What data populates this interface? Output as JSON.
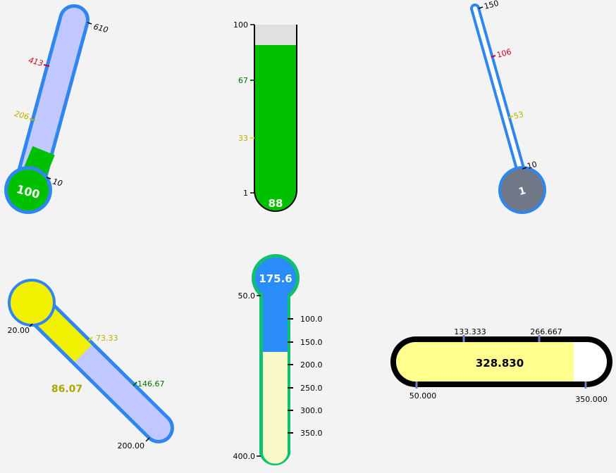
{
  "chart_data": [
    {
      "type": "thermometer",
      "value_label": "100",
      "ticks": [
        {
          "label": "10",
          "color": "#000000"
        },
        {
          "label": "206",
          "color": "#b8b000"
        },
        {
          "label": "413",
          "color": "#d0001a"
        },
        {
          "label": "610",
          "color": "#000000"
        }
      ],
      "range": [
        10,
        610
      ],
      "fill_level": 0.3,
      "colors": {
        "frame": "#2f86f0",
        "track": "#c0c8ff",
        "fill": "#00c000",
        "bulb": "#00c000",
        "value_text": "#ffffff"
      },
      "orientation": "tilted"
    },
    {
      "type": "thermometer",
      "value_label": "88",
      "ticks": [
        {
          "label": "1",
          "color": "#000000"
        },
        {
          "label": "33",
          "color": "#b8b000"
        },
        {
          "label": "67",
          "color": "#007000"
        },
        {
          "label": "100",
          "color": "#000000"
        }
      ],
      "range": [
        1,
        100
      ],
      "fill_level": 0.88,
      "colors": {
        "frame": "#000000",
        "track": "#e0e0e0",
        "fill": "#00c000",
        "bulb": "#00c000",
        "value_text": "#ffffff"
      },
      "orientation": "vertical"
    },
    {
      "type": "thermometer",
      "value_label": "1",
      "ticks": [
        {
          "label": "10",
          "color": "#000000"
        },
        {
          "label": "53",
          "color": "#b8b000"
        },
        {
          "label": "106",
          "color": "#d0001a"
        },
        {
          "label": "150",
          "color": "#000000"
        }
      ],
      "range": [
        10,
        150
      ],
      "fill_level": 0.0,
      "colors": {
        "frame": "#2f86f0",
        "track": "#ffffff",
        "fill": "#707888",
        "bulb": "#707888",
        "value_text": "#ffffff"
      },
      "orientation": "tilted"
    },
    {
      "type": "thermometer",
      "value_label": "86.07",
      "ticks": [
        {
          "label": "20.00",
          "color": "#000000"
        },
        {
          "label": "73.33",
          "color": "#b8b000"
        },
        {
          "label": "146.67",
          "color": "#007000"
        },
        {
          "label": "200.00",
          "color": "#000000"
        }
      ],
      "range": [
        20,
        200
      ],
      "fill_level": 0.37,
      "colors": {
        "frame": "#2f86f0",
        "track": "#c0c8ff",
        "fill": "#f0f000",
        "bulb": "#f0f000",
        "value_text": "#a8a800"
      },
      "orientation": "tilted-down"
    },
    {
      "type": "thermometer",
      "value_label": "175.6",
      "ticks": [
        {
          "label": "50.0",
          "color": "#000000"
        },
        {
          "label": "100.0",
          "color": "#000000"
        },
        {
          "label": "150.0",
          "color": "#000000"
        },
        {
          "label": "200.0",
          "color": "#000000"
        },
        {
          "label": "250.0",
          "color": "#000000"
        },
        {
          "label": "300.0",
          "color": "#000000"
        },
        {
          "label": "350.0",
          "color": "#000000"
        },
        {
          "label": "400.0",
          "color": "#000000"
        }
      ],
      "range": [
        50,
        400
      ],
      "fill_level": 0.36,
      "colors": {
        "frame": "#10c070",
        "track": "#f8f8c8",
        "fill": "#2a8cf8",
        "bulb": "#2a8cf8",
        "value_text": "#ffffff"
      },
      "orientation": "vertical-inverted"
    },
    {
      "type": "thermometer",
      "value_label": "328.830",
      "ticks": [
        {
          "label": "50.000",
          "color": "#000000"
        },
        {
          "label": "133.333",
          "color": "#000000"
        },
        {
          "label": "266.667",
          "color": "#000000"
        },
        {
          "label": "350.000",
          "color": "#000000"
        }
      ],
      "range": [
        50,
        350
      ],
      "fill_level": 0.93,
      "colors": {
        "frame": "#000000",
        "track": "#ffffff",
        "fill": "#ffff90",
        "bulb": "#ffff90",
        "tick": "#7080c8",
        "value_text": "#000000"
      },
      "orientation": "horizontal"
    }
  ]
}
